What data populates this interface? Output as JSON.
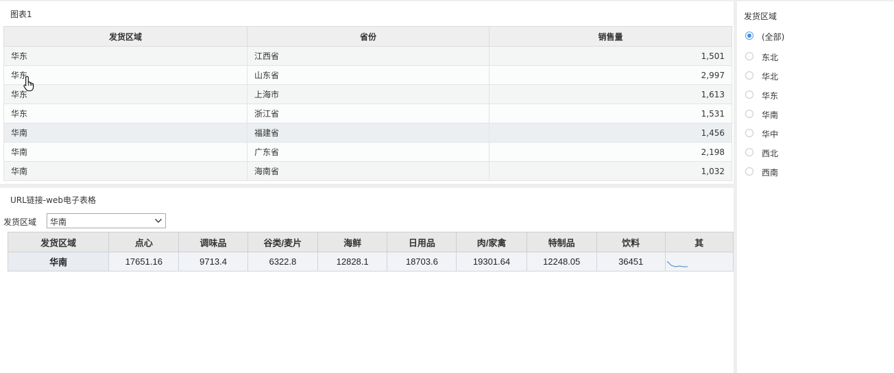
{
  "top_panel": {
    "title": "图表1",
    "columns": [
      "发货区域",
      "省份",
      "销售量"
    ],
    "rows": [
      {
        "region": "华东",
        "province": "江西省",
        "sales": "1,501"
      },
      {
        "region": "华东",
        "province": "山东省",
        "sales": "2,997"
      },
      {
        "region": "华东",
        "province": "上海市",
        "sales": "1,613"
      },
      {
        "region": "华东",
        "province": "浙江省",
        "sales": "1,531"
      },
      {
        "region": "华南",
        "province": "福建省",
        "sales": "1,456"
      },
      {
        "region": "华南",
        "province": "广东省",
        "sales": "2,198"
      },
      {
        "region": "华南",
        "province": "海南省",
        "sales": "1,032"
      }
    ]
  },
  "bottom_panel": {
    "title": "URL链接-web电子表格",
    "filter_label": "发货区域",
    "filter_value": "华南",
    "columns": [
      "发货区域",
      "点心",
      "调味品",
      "谷类/麦片",
      "海鲜",
      "日用品",
      "肉/家禽",
      "特制品",
      "饮料",
      "其"
    ],
    "row": [
      "华南",
      "17651.16",
      "9713.4",
      "6322.8",
      "12828.1",
      "18703.6",
      "19301.64",
      "12248.05",
      "36451",
      ""
    ]
  },
  "right_panel": {
    "title": "发货区域",
    "options": [
      {
        "label": "(全部)",
        "checked": true
      },
      {
        "label": "东北",
        "checked": false
      },
      {
        "label": "华北",
        "checked": false
      },
      {
        "label": "华东",
        "checked": false
      },
      {
        "label": "华南",
        "checked": false
      },
      {
        "label": "华中",
        "checked": false
      },
      {
        "label": "西北",
        "checked": false
      },
      {
        "label": "西南",
        "checked": false
      }
    ]
  },
  "colors": {
    "accent": "#3f8fe3",
    "header_bg": "#efefef"
  },
  "icons": {
    "cursor": "hand-pointer-icon",
    "dropdown": "chevron-down-icon"
  }
}
